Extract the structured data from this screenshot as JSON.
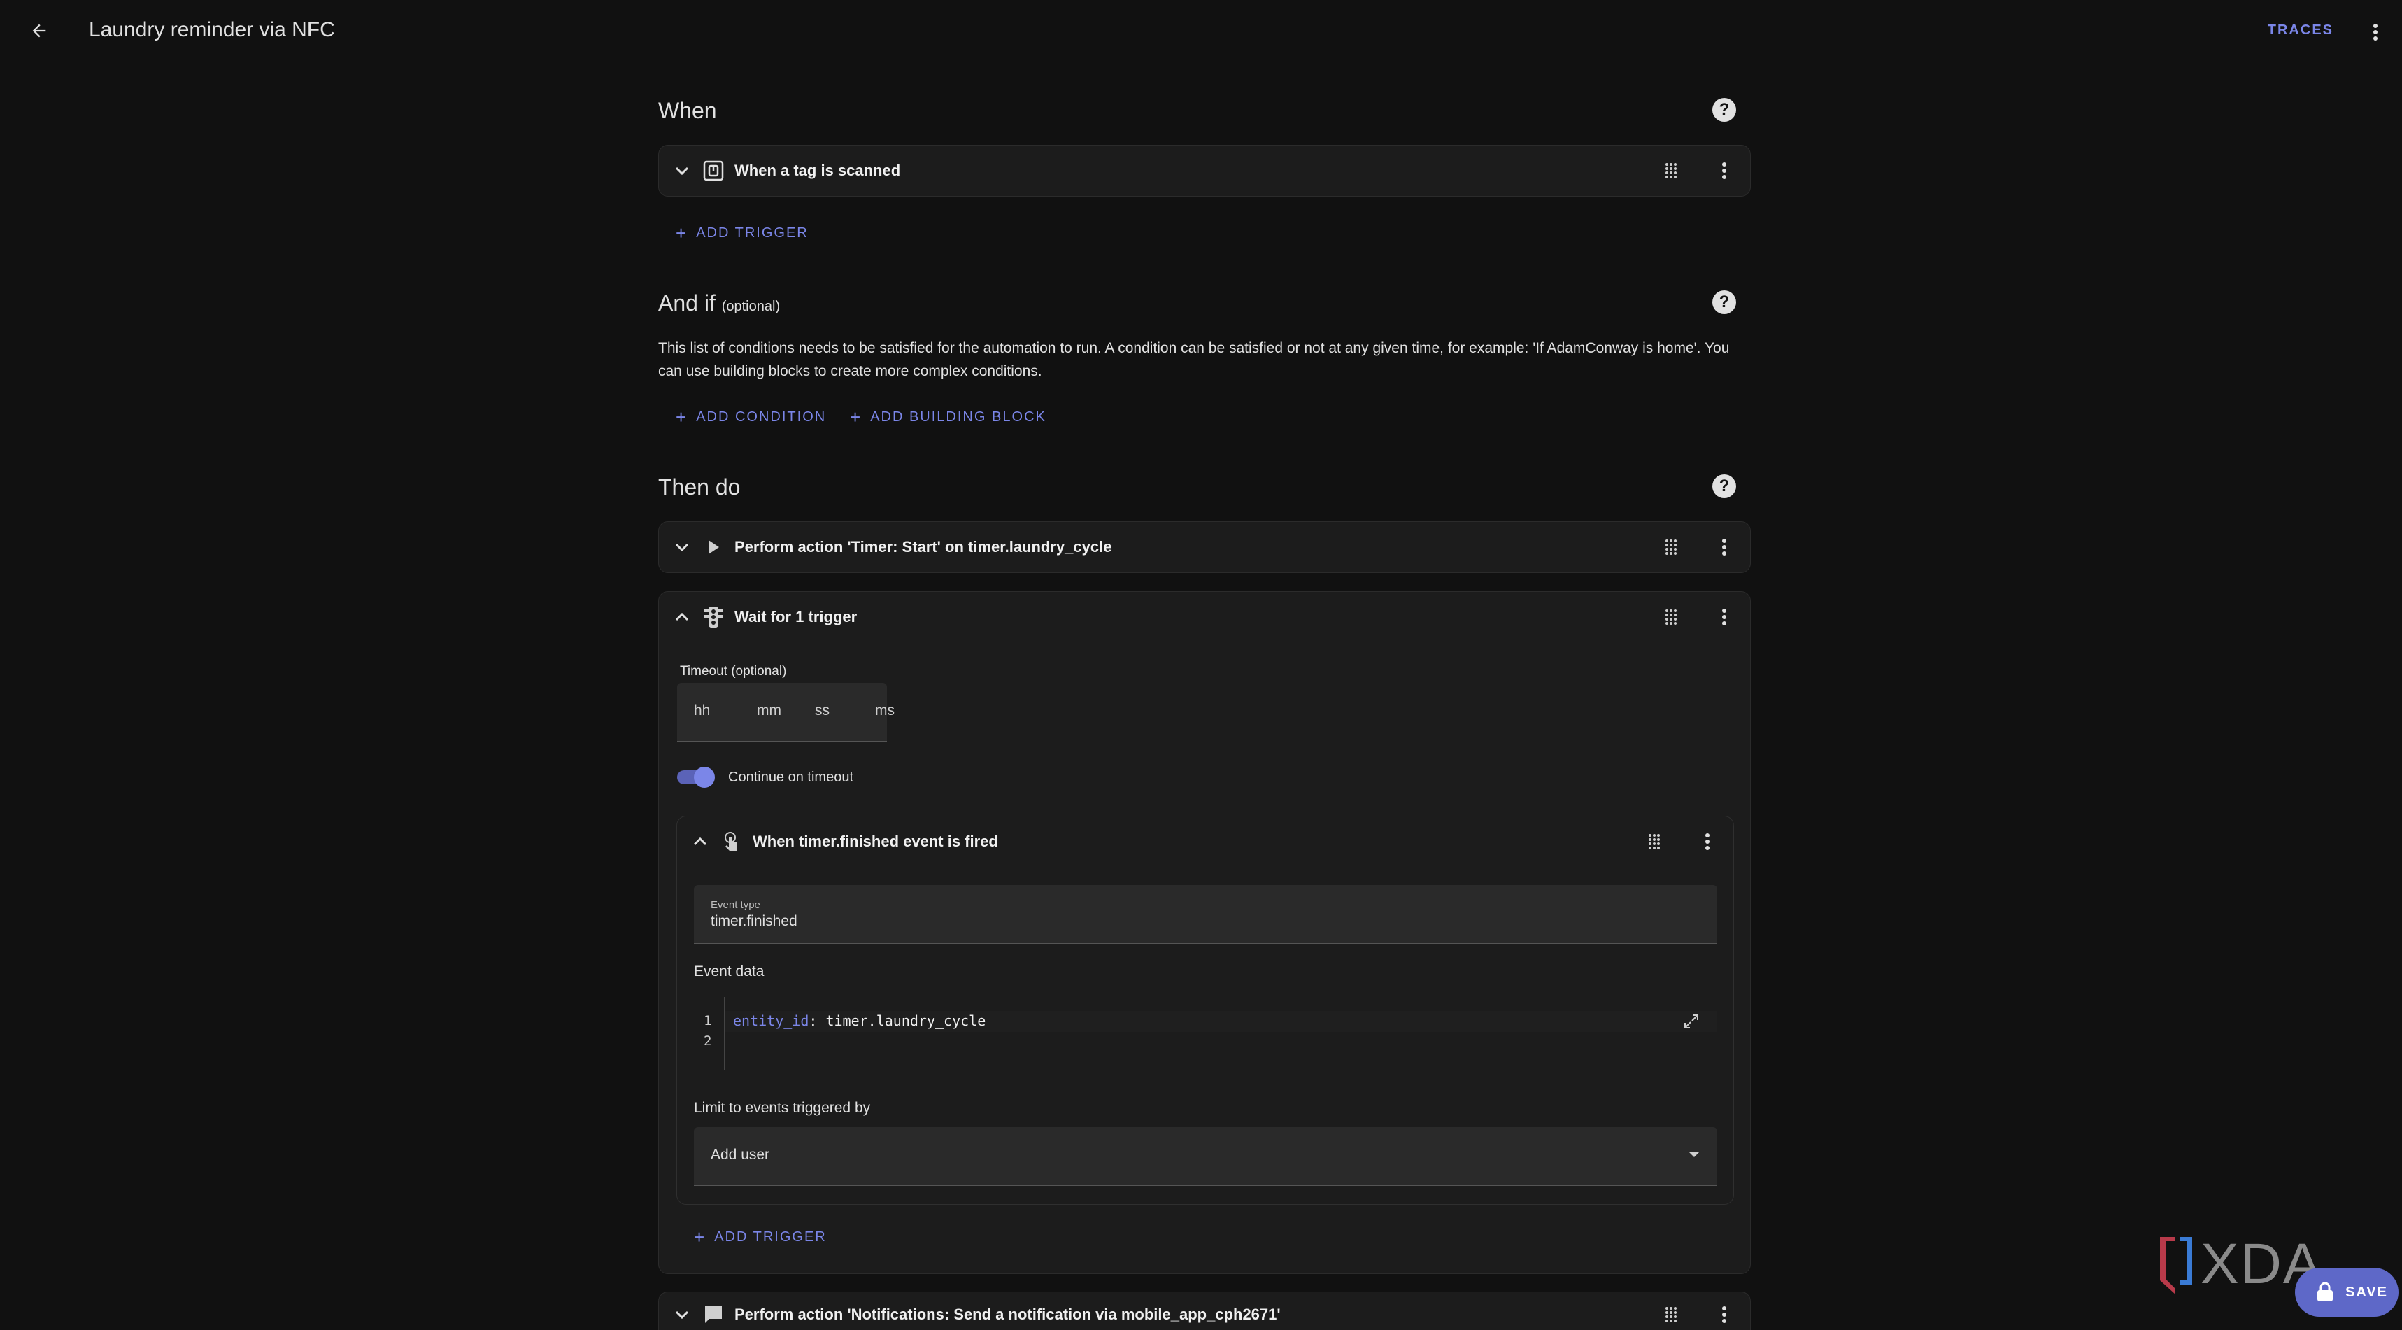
{
  "header": {
    "title": "Laundry reminder via NFC",
    "traces_label": "TRACES"
  },
  "when": {
    "title": "When",
    "trigger_label": "When a tag is scanned",
    "add_trigger": "ADD TRIGGER"
  },
  "and_if": {
    "title": "And if",
    "optional": "(optional)",
    "description": "This list of conditions needs to be satisfied for the automation to run. A condition can be satisfied or not at any given time, for example: 'If AdamConway is home'. You can use building blocks to create more complex conditions.",
    "add_condition": "ADD CONDITION",
    "add_building_block": "ADD BUILDING BLOCK"
  },
  "then_do": {
    "title": "Then do",
    "action1": "Perform action 'Timer: Start' on timer.laundry_cycle",
    "wait": {
      "label": "Wait for 1 trigger",
      "timeout_label": "Timeout (optional)",
      "hh": "hh",
      "mm": "mm",
      "ss": "ss",
      "ms": "ms",
      "continue_label": "Continue on timeout",
      "continue_on": true,
      "inner_trigger": {
        "label": "When timer.finished event is fired",
        "event_type_label": "Event type",
        "event_type_value": "timer.finished",
        "event_data_label": "Event data",
        "line1": "1",
        "line2": "2",
        "code_key": "entity_id",
        "code_value": ": timer.laundry_cycle",
        "limit_label": "Limit to events triggered by",
        "add_user": "Add user"
      },
      "add_trigger": "ADD TRIGGER"
    },
    "action2": "Perform action 'Notifications: Send a notification via mobile_app_cph2671'"
  },
  "fab": {
    "save_label": "SAVE"
  },
  "watermark": "XDA",
  "colors": {
    "accent": "#7b86e8",
    "background": "#111111",
    "card": "#1c1c1c"
  }
}
